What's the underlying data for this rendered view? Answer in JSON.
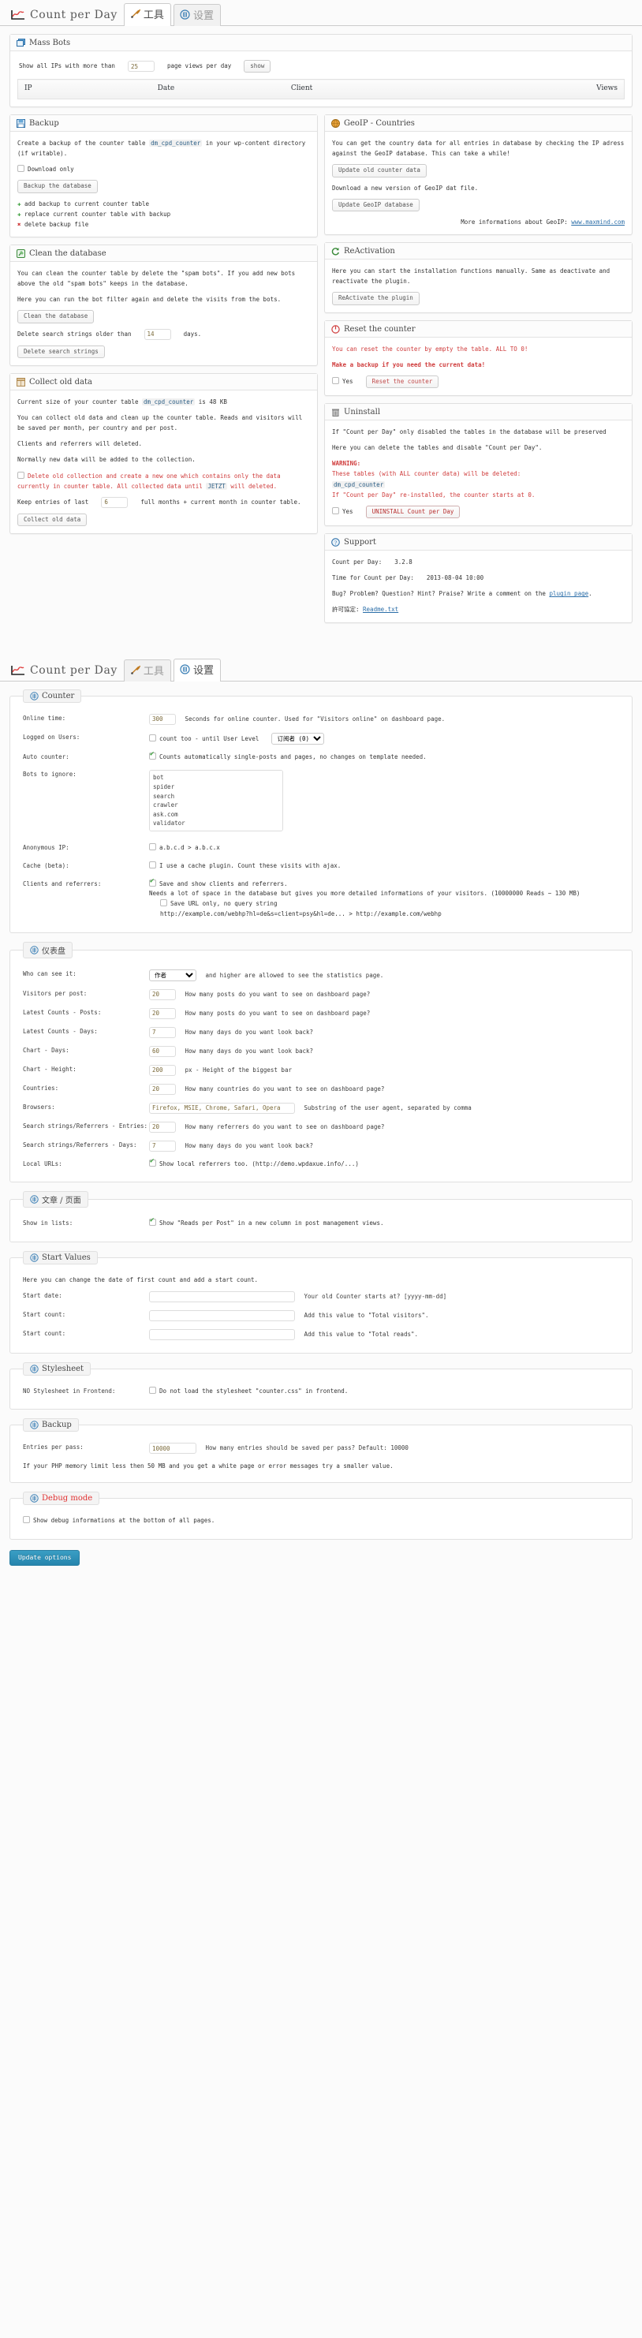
{
  "tools_page": {
    "brand": "Count per Day",
    "tabs": [
      {
        "label": "工具",
        "icon": "wrench-icon",
        "active": true
      },
      {
        "label": "设置",
        "icon": "gear-icon",
        "active": false
      }
    ],
    "mass_bots": {
      "title": "Mass Bots",
      "icon": "windows-icon",
      "prefix": "Show all IPs with more than",
      "threshold": "25",
      "suffix": "page views per day",
      "show_button": "show",
      "columns": [
        "IP",
        "Date",
        "Client",
        "Views"
      ]
    },
    "backup": {
      "title": "Backup",
      "icon": "floppy-icon",
      "desc": "Create a backup of the counter table dm_cpd_counter in your wp-content directory (if writable).",
      "desc_code": "dm_cpd_counter",
      "download_only": "Download only",
      "download_only_checked": false,
      "button": "Backup the database",
      "legend": [
        {
          "mark": "✚",
          "type": "add",
          "text": "add backup to current counter table"
        },
        {
          "mark": "✚",
          "type": "rep",
          "text": "replace current counter table with backup"
        },
        {
          "mark": "✖",
          "type": "del",
          "text": "delete backup file"
        }
      ]
    },
    "clean_db": {
      "title": "Clean the database",
      "icon": "broom-icon",
      "desc": "You can clean the counter table by delete the \"spam bots\". If you add new bots above the old \"spam bots\" keeps in the database.",
      "desc2": "Here you can run the bot filter again and delete the visits from the bots.",
      "button": "Clean the database",
      "del_prefix": "Delete search strings older than",
      "del_days": "14",
      "del_suffix": "days.",
      "del_button": "Delete search strings"
    },
    "collect_old": {
      "title": "Collect old data",
      "icon": "box-icon",
      "desc_prefix": "Current size of your counter table",
      "desc_code": "dm_cpd_counter",
      "desc_suffix": "is 48 KB",
      "p1": "You can collect old data and clean up the counter table. Reads and visitors will be saved per month, per country and per post.",
      "p2": "Clients and referrers will deleted.",
      "p3": "Normally new data will be added to the collection.",
      "warn1": "Delete old collection and create a new one which contains only the data currently in counter table. All collected data until",
      "warn_code": "JETZT",
      "warn2": "will deleted.",
      "warn_checked": false,
      "keep_prefix": "Keep entries of last",
      "keep_months": "6",
      "keep_suffix": "full months + current month in counter table.",
      "button": "Collect old data"
    },
    "geoip": {
      "title": "GeoIP - Countries",
      "icon": "globe-icon",
      "p1": "You can get the country data for all entries in database by checking the IP adress against the GeoIP database. This can take a while!",
      "btn1": "Update old counter data",
      "p2": "Download a new version of GeoIP dat file.",
      "btn2": "Update GeoIP database",
      "p3": "More informations about GeoIP:",
      "link": "www.maxmind.com"
    },
    "reactivation": {
      "title": "ReActivation",
      "icon": "refresh-icon",
      "p1": "Here you can start the installation functions manually. Same as deactivate and reactivate the plugin.",
      "button": "ReActivate the plugin"
    },
    "reset": {
      "title": "Reset the counter",
      "icon": "reset-icon",
      "p1": "You can reset the counter by empty the table. ALL TO 0!",
      "p2": "Make a backup if you need the current data!",
      "checkbox": "Yes",
      "checked": false,
      "button": "Reset the counter"
    },
    "uninstall": {
      "title": "Uninstall",
      "icon": "trash-icon",
      "p1": "If \"Count per Day\" only disabled the tables in the database will be preserved",
      "p2": "Here you can delete the tables and disable \"Count per Day\".",
      "warning": "WARNING:",
      "w1": "These tables (with ALL counter data) will be deleted:",
      "w_code": "dm_cpd_counter",
      "w2": "If \"Count per Day\" re-installed, the counter starts at 0.",
      "checkbox": "Yes",
      "checked": false,
      "button": "UNINSTALL Count per Day"
    },
    "support": {
      "title": "Support",
      "icon": "support-icon",
      "version_label": "Count per Day:",
      "version": "3.2.8",
      "time_label": "Time for Count per Day:",
      "time": "2013-08-04 10:00",
      "p1": "Bug? Problem? Question? Hint? Praise? Write a comment on the",
      "link1": "plugin page",
      "link1_suffix": ".",
      "license_label": "許可協定:",
      "license_link": "Readme.txt"
    }
  },
  "settings_page": {
    "brand": "Count per Day",
    "tabs": [
      {
        "label": "工具",
        "icon": "wrench-icon",
        "active": false
      },
      {
        "label": "设置",
        "icon": "gear-icon",
        "active": true
      }
    ],
    "counter": {
      "legend": "Counter",
      "icon": "gear-icon",
      "rows": [
        {
          "label": "Online time:",
          "value": "300",
          "hint": "Seconds for online counter. Used for \"Visitors online\" on dashboard page."
        },
        {
          "label": "Logged on Users:",
          "check": "count too - until User Level",
          "checked": false,
          "select": "订阅者 (0)"
        },
        {
          "label": "Auto counter:",
          "check": "Counts automatically single-posts and pages, no changes on template needed.",
          "checked": true
        },
        {
          "label": "Bots to ignore:",
          "textarea": "bot\nspider\nsearch\ncrawler\nask.com\nvalidator\nsnoopy\nsuchen.de\nsuchbaer.de\nshelob"
        },
        {
          "label": "Anonymous IP:",
          "check": "a.b.c.d > a.b.c.x",
          "checked": false
        },
        {
          "label": "Cache (beta):",
          "check": "I use a cache plugin. Count these visits with ajax.",
          "checked": false
        },
        {
          "label": "Clients and referrers:",
          "check": "Save and show clients and referrers.",
          "checked": true,
          "hint": "Needs a lot of space in the database but gives you more detailed informations of your visitors. (10000000 Reads ~ 130 MB)",
          "check2": "Save URL only, no query string",
          "checked2": false,
          "hint2": "http://example.com/webhp?hl=de&s=client=psy&hl=de...  >  http://example.com/webhp"
        }
      ]
    },
    "dashboard": {
      "legend": "仪表盘",
      "icon": "gear-icon",
      "rows": [
        {
          "label": "Who can see it:",
          "select": "作者",
          "hint": "and higher are allowed to see the statistics page."
        },
        {
          "label": "Visitors per post:",
          "value": "20",
          "hint": "How many posts do you want to see on dashboard page?"
        },
        {
          "label": "Latest Counts - Posts:",
          "value": "20",
          "hint": "How many posts do you want to see on dashboard page?"
        },
        {
          "label": "Latest Counts - Days:",
          "value": "7",
          "hint": "How many days do you want look back?"
        },
        {
          "label": "Chart - Days:",
          "value": "60",
          "hint": "How many days do you want look back?"
        },
        {
          "label": "Chart - Height:",
          "value": "200",
          "hint": "px - Height of the biggest bar"
        },
        {
          "label": "Countries:",
          "value": "20",
          "hint": "How many countries do you want to see on dashboard page?"
        },
        {
          "label": "Browsers:",
          "value": "Firefox, MSIE, Chrome, Safari, Opera",
          "wide": true,
          "hint": "Substring of the user agent, separated by comma"
        },
        {
          "label": "Search strings/Referrers - Entries:",
          "value": "20",
          "hint": "How many referrers do you want to see on dashboard page?"
        },
        {
          "label": "Search strings/Referrers - Days:",
          "value": "7",
          "hint": "How many days do you want look back?"
        },
        {
          "label": "Local URLs:",
          "check": "Show local referrers too. (http://demo.wpdaxue.info/...)",
          "checked": true
        }
      ]
    },
    "posts": {
      "legend": "文章 / 页面",
      "icon": "gear-icon",
      "rows": [
        {
          "label": "Show in lists:",
          "check": "Show \"Reads per Post\" in a new column in post management views.",
          "checked": true
        }
      ]
    },
    "start_values": {
      "legend": "Start Values",
      "icon": "gear-icon",
      "note": "Here you can change the date of first count and add a start count.",
      "rows": [
        {
          "label": "Start date:",
          "value": "",
          "hint": "Your old Counter starts at? [yyyy-mm-dd]"
        },
        {
          "label": "Start count:",
          "value": "",
          "hint": "Add this value to \"Total visitors\"."
        },
        {
          "label": "Start count:",
          "value": "",
          "hint": "Add this value to \"Total reads\"."
        }
      ]
    },
    "stylesheet": {
      "legend": "Stylesheet",
      "icon": "gear-icon",
      "rows": [
        {
          "label": "NO Stylesheet in Frontend:",
          "check": "Do not load the stylesheet \"counter.css\" in frontend.",
          "checked": false
        }
      ]
    },
    "backup": {
      "legend": "Backup",
      "icon": "gear-icon",
      "rows": [
        {
          "label": "Entries per pass:",
          "value": "10000",
          "hint": "How many entries should be saved per pass? Default: 10000"
        }
      ],
      "note": "If your PHP memory limit less then 50 MB and you get a white page or error messages try a smaller value."
    },
    "debug": {
      "legend": "Debug mode",
      "icon": "gear-icon",
      "check": "Show debug informations at the bottom of all pages.",
      "checked": false
    },
    "submit": "Update options"
  }
}
